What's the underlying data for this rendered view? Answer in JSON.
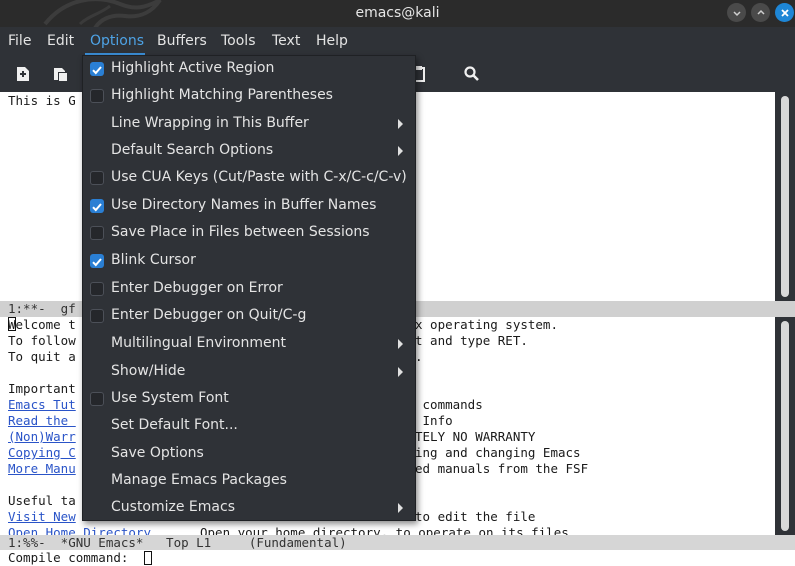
{
  "window": {
    "title": "emacs@kali"
  },
  "menubar": {
    "items": [
      {
        "label": "File"
      },
      {
        "label": "Edit"
      },
      {
        "label": "Options"
      },
      {
        "label": "Buffers"
      },
      {
        "label": "Tools"
      },
      {
        "label": "Text"
      },
      {
        "label": "Help"
      }
    ]
  },
  "toolbar": {
    "icons": [
      "new-file-icon",
      "open-file-icon",
      "paste-icon",
      "search-icon"
    ]
  },
  "options_menu": {
    "items": [
      {
        "label": "Highlight Active Region",
        "checkbox": true,
        "checked": true
      },
      {
        "label": "Highlight Matching Parentheses",
        "checkbox": true,
        "checked": false
      },
      {
        "label": "Line Wrapping in This Buffer",
        "submenu": true
      },
      {
        "label": "Default Search Options",
        "submenu": true
      },
      {
        "label": "Use CUA Keys (Cut/Paste with C-x/C-c/C-v)",
        "checkbox": true,
        "checked": false
      },
      {
        "label": "Use Directory Names in Buffer Names",
        "checkbox": true,
        "checked": true
      },
      {
        "label": "Save Place in Files between Sessions",
        "checkbox": true,
        "checked": false
      },
      {
        "label": "Blink Cursor",
        "checkbox": true,
        "checked": true
      },
      {
        "label": "Enter Debugger on Error",
        "checkbox": true,
        "checked": false
      },
      {
        "label": "Enter Debugger on Quit/C-g",
        "checkbox": true,
        "checked": false
      },
      {
        "label": "Multilingual Environment",
        "submenu": true
      },
      {
        "label": "Show/Hide",
        "submenu": true
      },
      {
        "label": "Use System Font",
        "checkbox": true,
        "checked": false
      },
      {
        "label": "Set Default Font..."
      },
      {
        "label": "Save Options"
      },
      {
        "label": "Manage Emacs Packages"
      },
      {
        "label": "Customize Emacs",
        "submenu": true
      }
    ]
  },
  "upper_buffer": {
    "lines": [
      "This is G"
    ]
  },
  "upper_modeline": {
    "text": "1:**-  gf"
  },
  "lower_buffer": {
    "left_fragments": [
      "Welcome t",
      "To follow",
      "To quit a",
      "",
      "Important",
      "Emacs Tut",
      "Read the ",
      "(Non)Warr",
      "Copying C",
      "More Manu",
      "",
      "Useful ta",
      "Visit New",
      "Open Home Directory"
    ],
    "right_fragments": [
      "x operating system.",
      "t and type RET.",
      ".",
      "",
      "",
      " commands",
      " Info",
      "TELY NO WARRANTY",
      "ing and changing Emacs",
      "ed manuals from the FSF",
      "",
      "",
      "to edit the file",
      "Open your home directory, to operate on its files"
    ],
    "link_rows": [
      5,
      6,
      7,
      8,
      9,
      12,
      13
    ]
  },
  "modeline": {
    "text": "1:%%-  *GNU Emacs*   Top L1     (Fundamental)"
  },
  "minibuffer": {
    "prompt": "Compile command: "
  },
  "colors": {
    "accent": "#2a7fd4",
    "menu_bg": "#2f3237",
    "link": "#2a54c8"
  }
}
